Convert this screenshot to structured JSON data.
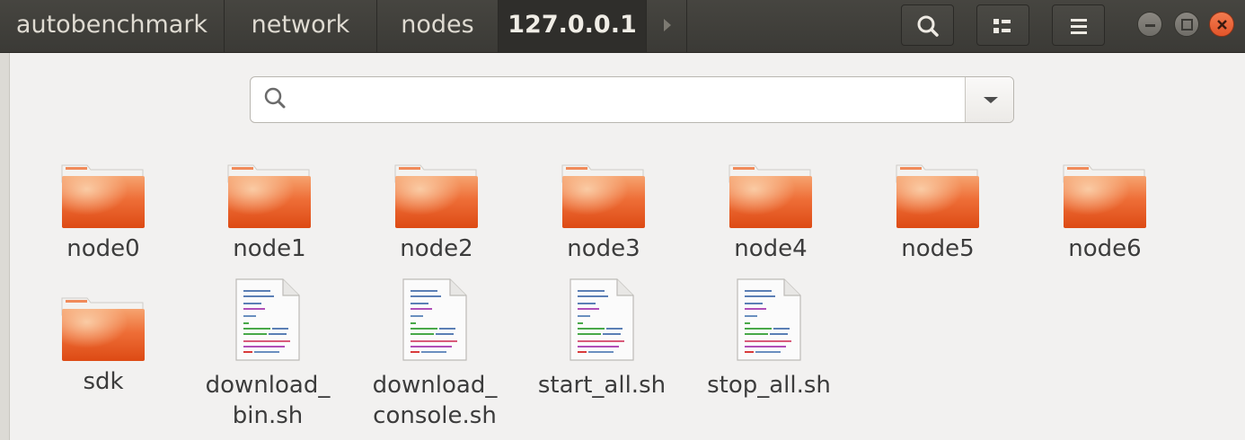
{
  "breadcrumbs": [
    "autobenchmark",
    "network",
    "nodes",
    "127.0.0.1"
  ],
  "header_buttons": [
    "search-icon",
    "view-options-icon",
    "menu-icon"
  ],
  "window_controls": [
    "minimize",
    "maximize",
    "close"
  ],
  "search": {
    "value": "",
    "placeholder": ""
  },
  "colors": {
    "headerbar": "#3b3a36",
    "folder": "#e95420",
    "close": "#e2552a",
    "background": "#f2f1f0"
  },
  "items": [
    {
      "name": "node0",
      "type": "folder"
    },
    {
      "name": "node1",
      "type": "folder"
    },
    {
      "name": "node2",
      "type": "folder"
    },
    {
      "name": "node3",
      "type": "folder"
    },
    {
      "name": "node4",
      "type": "folder"
    },
    {
      "name": "node5",
      "type": "folder"
    },
    {
      "name": "node6",
      "type": "folder"
    },
    {
      "name": "sdk",
      "type": "folder"
    },
    {
      "name": "download_bin.sh",
      "label_lines": [
        "download_",
        "bin.sh"
      ],
      "type": "script"
    },
    {
      "name": "download_console.sh",
      "label_lines": [
        "download_",
        "console.sh"
      ],
      "type": "script"
    },
    {
      "name": "start_all.sh",
      "type": "script"
    },
    {
      "name": "stop_all.sh",
      "type": "script"
    }
  ]
}
